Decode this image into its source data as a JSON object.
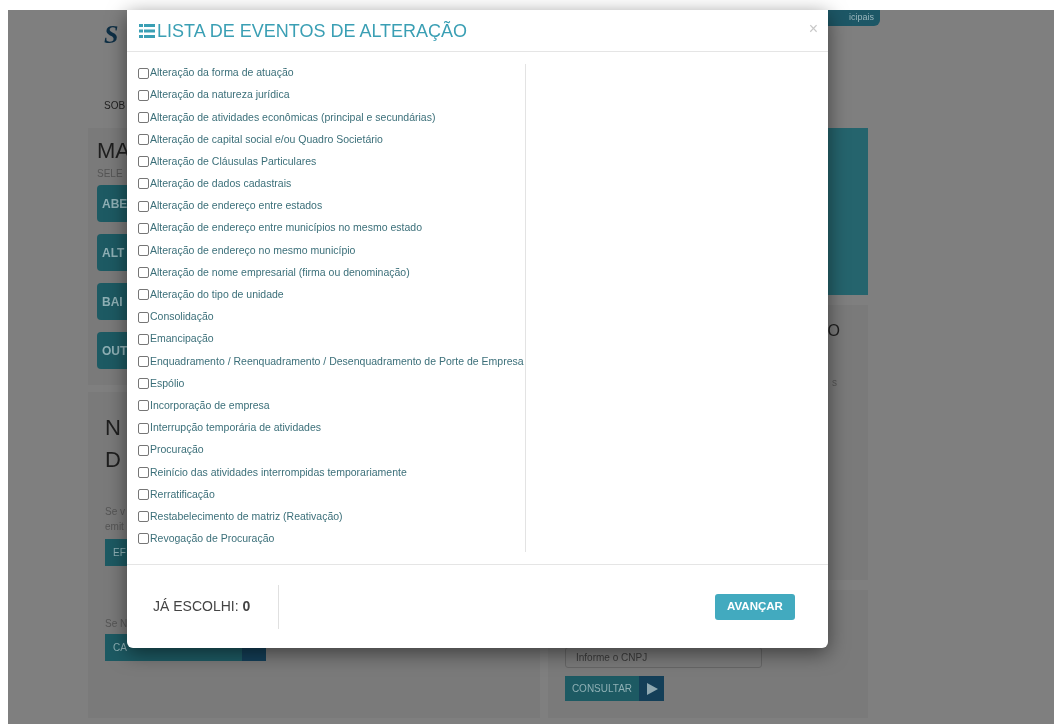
{
  "background": {
    "logo": "S",
    "tab": "icipais",
    "nav": "SOB",
    "panel_title": "MA",
    "panel_subtitle": "SELE",
    "menu_buttons": [
      "ABE",
      "ALT",
      "BAI",
      "OUT"
    ],
    "right_texts": [
      "O",
      "s"
    ],
    "lower_title": [
      "N",
      "D"
    ],
    "lower_texts": [
      "Se v",
      "emit"
    ],
    "lower_button": "EF",
    "lower_note": "Se N",
    "lower_button_2": "CA",
    "cnpj": {
      "placeholder": "Informe o CNPJ"
    },
    "consultar": "CONSULTAR"
  },
  "modal": {
    "title": "LISTA DE EVENTOS DE ALTERAÇÃO",
    "close": "×",
    "events": [
      {
        "label": "Alteração da forma de atuação",
        "checked": false
      },
      {
        "label": "Alteração da natureza jurídica",
        "checked": false
      },
      {
        "label": "Alteração de atividades econômicas (principal e secundárias)",
        "checked": false
      },
      {
        "label": "Alteração de capital social e/ou Quadro Societário",
        "checked": false
      },
      {
        "label": "Alteração de Cláusulas Particulares",
        "checked": false
      },
      {
        "label": "Alteração de dados cadastrais",
        "checked": false
      },
      {
        "label": "Alteração de endereço entre estados",
        "checked": false
      },
      {
        "label": "Alteração de endereço entre municípios no mesmo estado",
        "checked": false
      },
      {
        "label": "Alteração de endereço no mesmo município",
        "checked": false
      },
      {
        "label": "Alteração de nome empresarial (firma ou denominação)",
        "checked": false
      },
      {
        "label": "Alteração do tipo de unidade",
        "checked": false
      },
      {
        "label": "Consolidação",
        "checked": false
      },
      {
        "label": "Emancipação",
        "checked": false
      },
      {
        "label": "Enquadramento / Reenquadramento / Desenquadramento de Porte de Empresa",
        "checked": false
      },
      {
        "label": "Espólio",
        "checked": false
      },
      {
        "label": "Incorporação de empresa",
        "checked": false
      },
      {
        "label": "Interrupção temporária de atividades",
        "checked": false
      },
      {
        "label": "Procuração",
        "checked": false
      },
      {
        "label": "Reinício das atividades interrompidas temporariamente",
        "checked": false
      },
      {
        "label": "Rerratificação",
        "checked": false
      },
      {
        "label": "Restabelecimento de matriz (Reativação)",
        "checked": false
      },
      {
        "label": "Revogação de Procuração",
        "checked": false
      }
    ],
    "chosen": "JÁ ESCOLHI: **0**",
    "next_button": "AVANÇAR"
  }
}
